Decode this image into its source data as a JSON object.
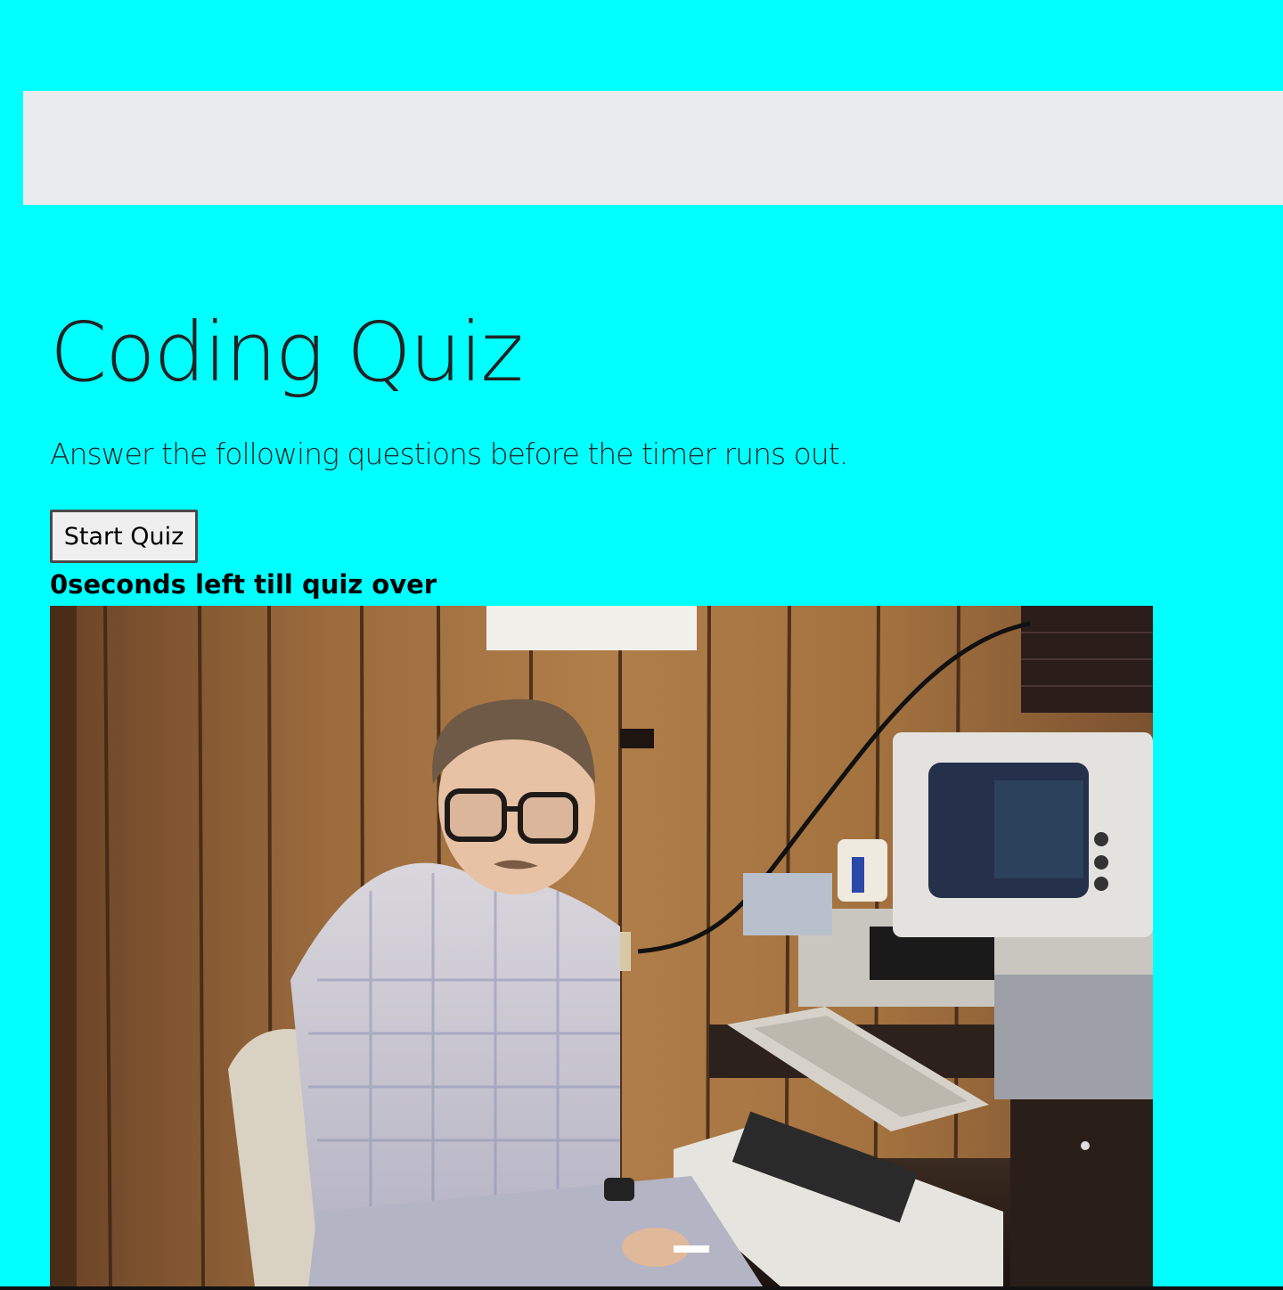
{
  "theme": {
    "page_background": "#00ffff",
    "nav_background": "#e9ecef",
    "text_color": "#222222"
  },
  "jumbotron": {
    "title": "Coding Quiz",
    "lead": "Answer the following questions before the timer runs out."
  },
  "controls": {
    "start_label": "Start Quiz"
  },
  "timer": {
    "text": "0seconds left till quiz over"
  },
  "image": {
    "subject": "computer-nerd-photo"
  }
}
